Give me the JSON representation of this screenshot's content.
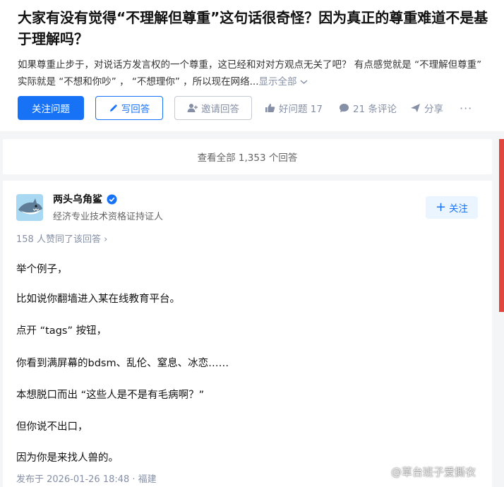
{
  "question": {
    "title": "大家有没有觉得“不理解但尊重”这句话很奇怪？因为真正的尊重难道不是基于理解吗？",
    "description": "如果尊重止步于，对说话方发言权的一个尊重，这已经和对对方观点无关了吧？ 有点感觉就是 “不理解但尊重” 实际就是 “不想和你吵” ， “不想理你” ，所以现在网络...",
    "show_all": "显示全部",
    "buttons": {
      "follow": "关注问题",
      "write": "写回答",
      "invite": "邀请回答"
    },
    "actions": {
      "good_question": "好问题 17",
      "comments": "21 条评论",
      "share": "分享",
      "more": "···"
    }
  },
  "view_all_answers": "查看全部 1,353 个回答",
  "answer": {
    "author": {
      "name": "两头乌角鲨",
      "bio": "经济专业技术资格证持证人",
      "follow_label": "关注"
    },
    "vote_summary": "158 人赞同了该回答",
    "vote_chevron": "›",
    "paragraphs": [
      "举个例子，",
      "比如说你翻墙进入某在线教育平台。",
      "点开 “tags” 按钮，",
      "你看到满屏幕的bdsm、乱伦、窒息、冰恋……",
      "本想脱口而出 “这些人是不是有毛病啊？”",
      "但你说不出口，",
      "因为你是来找人兽的。"
    ],
    "published": "发布于 2026-01-26 18:48 · 福建"
  },
  "watermark": "@草台班子爱撕衣",
  "colors": {
    "primary": "#1772f6",
    "muted": "#8590a6",
    "background": "#f4f5f7",
    "side_bar": "#e2453c"
  },
  "icons": [
    "pencil-icon",
    "person-add-icon",
    "thumb-up-icon",
    "comment-icon",
    "share-icon",
    "verified-icon",
    "plus-icon",
    "chevron-down-icon",
    "weibo-icon"
  ]
}
